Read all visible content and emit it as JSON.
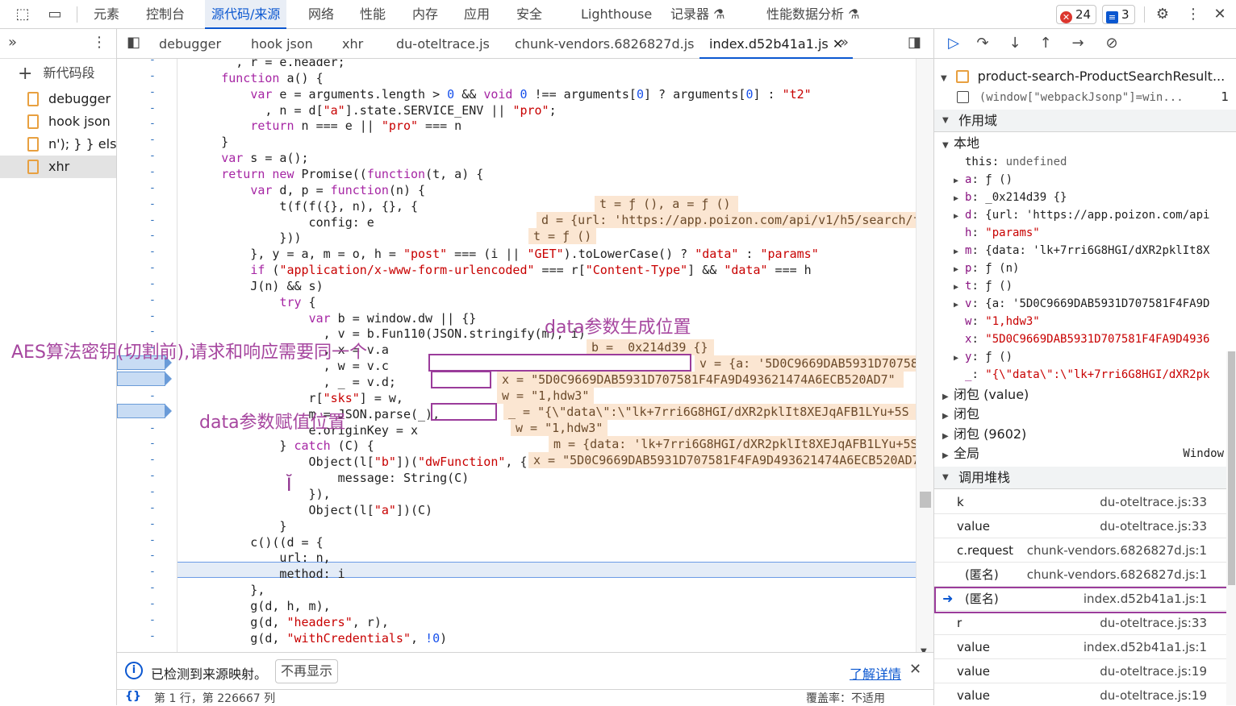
{
  "topbar": {
    "tabs": [
      "元素",
      "控制台",
      "源代码/来源",
      "网络",
      "性能",
      "内存",
      "应用",
      "安全",
      "Lighthouse",
      "记录器",
      "性能数据分析"
    ],
    "errors_count": "24",
    "messages_count": "3"
  },
  "navigator": {
    "new_snippet": "新代码段",
    "files": [
      "debugger",
      "hook json",
      "n'); } } else i",
      "xhr"
    ]
  },
  "editor": {
    "tabs": [
      "debugger",
      "hook json",
      "xhr",
      "du-oteltrace.js",
      "chunk-vendors.6826827d.js",
      "index.d52b41a1.js"
    ],
    "lines": [
      "        , r = e.header;",
      "      function a() {",
      "          var e = arguments.length > 0 && void 0 !== arguments[0] ? arguments[0] : \"t2\"",
      "            , n = d[\"a\"].state.SERVICE_ENV || \"pro\";",
      "          return n === e || \"pro\" === n",
      "      }",
      "      var s = a();",
      "      return new Promise((function(t, a) {",
      "          var d, p = function(n) {",
      "              t(f(f({}, n), {}, {",
      "                  config: e",
      "              }))",
      "          }, y = a, m = o, h = \"post\" === (i || \"GET\").toLowerCase() ? \"data\" : \"params\"",
      "          if (\"application/x-www-form-urlencoded\" === r[\"Content-Type\"] && \"data\" === h",
      "          J(n) && s)",
      "              try {",
      "                  var b = window.dw || {}",
      "                    , v = b.Fun110(JSON.stringify(m), i)",
      "                    , x = v.a",
      "                    , w = v.c",
      "                    , _ = v.d;",
      "                  r[\"sks\"] = w,",
      "                  m = JSON.parse(_),",
      "                  e.originKey = x",
      "              } catch (C) {",
      "                  Object(l[\"b\"])(\"dwFunction\", {",
      "                      message: String(C)",
      "                  }),",
      "                  Object(l[\"a\"])(C)",
      "              }",
      "          c()((d = {",
      "              url: n,",
      "              method: i",
      "          },",
      "          g(d, h, m),",
      "          g(d, \"headers\", r),",
      "          g(d, \"withCredentials\", !0)"
    ],
    "inline_values": {
      "t": "t = ƒ (), a = ƒ ()",
      "d": "d = {url: 'https://app.poizon.com/api/v1/h5/search/f",
      "t2": "t = ƒ ()",
      "b": "b = _0x214d39 {}",
      "v": "v = {a: '5D0C9669DAB5931D70758",
      "x": "x = \"5D0C9669DAB5931D707581F4FA9D493621474A6ECB520AD7\"",
      "w": "w = \"1,hdw3\"",
      "_": "_ = \"{\\\"data\\\":\\\"lk+7rri6G8HGI/dXR2pklIt8XEJqAFB1LYu+5S",
      "w2": "w = \"1,hdw3\"",
      "m": "m = {data: 'lk+7rri6G8HGI/dXR2pklIt8XEJqAFB1LYu+5S",
      "x2": "x = \"5D0C9669DAB5931D707581F4FA9D493621474A6ECB520AD7"
    },
    "annotations": {
      "gen": "data参数生成位置",
      "aes": "AES算法密钥(切割前),请求和响应需要同一个",
      "assign": "data参数赋值位置"
    },
    "info_text": "已检测到来源映射。",
    "info_button": "不再显示",
    "info_link": "了解详情",
    "status_left": "第 1 行，第 226667 列",
    "status_right": "覆盖率：不适用"
  },
  "right": {
    "watch_item1": "product-search-ProductSearchResult...",
    "watch_item2": "(window[\"webpackJsonp\"]=win...",
    "watch_item2_count": "1",
    "scope_title": "作用域",
    "local_title": "本地",
    "scope": [
      {
        "k": "this",
        "v": "undefined"
      },
      {
        "k": "a",
        "v": "ƒ ()"
      },
      {
        "k": "b",
        "v": "_0x214d39 {}"
      },
      {
        "k": "d",
        "v": "{url: 'https://app.poizon.com/api"
      },
      {
        "k": "h",
        "v": "\"params\""
      },
      {
        "k": "m",
        "v": "{data: 'lk+7rri6G8HGI/dXR2pklIt8X"
      },
      {
        "k": "p",
        "v": "ƒ (n)"
      },
      {
        "k": "t",
        "v": "ƒ ()"
      },
      {
        "k": "v",
        "v": "{a: '5D0C9669DAB5931D707581F4FA9D"
      },
      {
        "k": "w",
        "v": "\"1,hdw3\""
      },
      {
        "k": "x",
        "v": "\"5D0C9669DAB5931D707581F4FA9D4936"
      },
      {
        "k": "y",
        "v": "ƒ ()"
      },
      {
        "k": "_",
        "v": "\"{\\\"data\\\":\\\"lk+7rri6G8HGI/dXR2pk"
      }
    ],
    "closures": [
      "闭包 (value)",
      "闭包",
      "闭包 (9602)"
    ],
    "global_label": "全局",
    "global_value": "Window",
    "callstack_title": "调用堆栈",
    "callstack": [
      {
        "fn": "k",
        "loc": "du-oteltrace.js:33"
      },
      {
        "fn": "value",
        "loc": "du-oteltrace.js:33"
      },
      {
        "fn": "c.request",
        "loc": "chunk-vendors.6826827d.js:1"
      },
      {
        "fn": "(匿名)",
        "loc": "chunk-vendors.6826827d.js:1"
      },
      {
        "fn": "(匿名)",
        "loc": "index.d52b41a1.js:1"
      },
      {
        "fn": "r",
        "loc": "du-oteltrace.js:33"
      },
      {
        "fn": "value",
        "loc": "index.d52b41a1.js:1"
      },
      {
        "fn": "value",
        "loc": "du-oteltrace.js:19"
      },
      {
        "fn": "value",
        "loc": "du-oteltrace.js:19"
      }
    ]
  }
}
